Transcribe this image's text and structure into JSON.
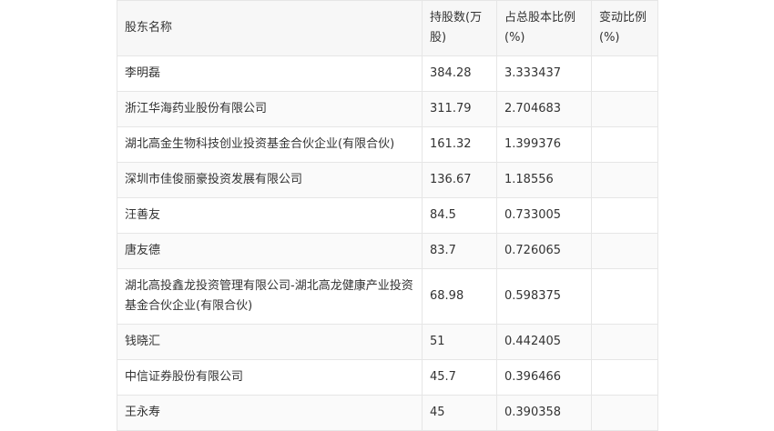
{
  "table": {
    "headers": [
      "股东名称",
      "持股数(万股)",
      "占总股本比例(%)",
      "变动比例(%)"
    ],
    "rows": [
      [
        "李明磊",
        "384.28",
        "3.333437",
        ""
      ],
      [
        "浙江华海药业股份有限公司",
        "311.79",
        "2.704683",
        ""
      ],
      [
        "湖北高金生物科技创业投资基金合伙企业(有限合伙)",
        "161.32",
        "1.399376",
        ""
      ],
      [
        "深圳市佳俊丽豪投资发展有限公司",
        "136.67",
        "1.18556",
        ""
      ],
      [
        "汪善友",
        "84.5",
        "0.733005",
        ""
      ],
      [
        "唐友德",
        "83.7",
        "0.726065",
        ""
      ],
      [
        "湖北高投鑫龙投资管理有限公司-湖北高龙健康产业投资基金合伙企业(有限合伙)",
        "68.98",
        "0.598375",
        ""
      ],
      [
        "钱晓汇",
        "51",
        "0.442405",
        ""
      ],
      [
        "中信证券股份有限公司",
        "45.7",
        "0.396466",
        ""
      ],
      [
        "王永寿",
        "45",
        "0.390358",
        ""
      ]
    ]
  }
}
